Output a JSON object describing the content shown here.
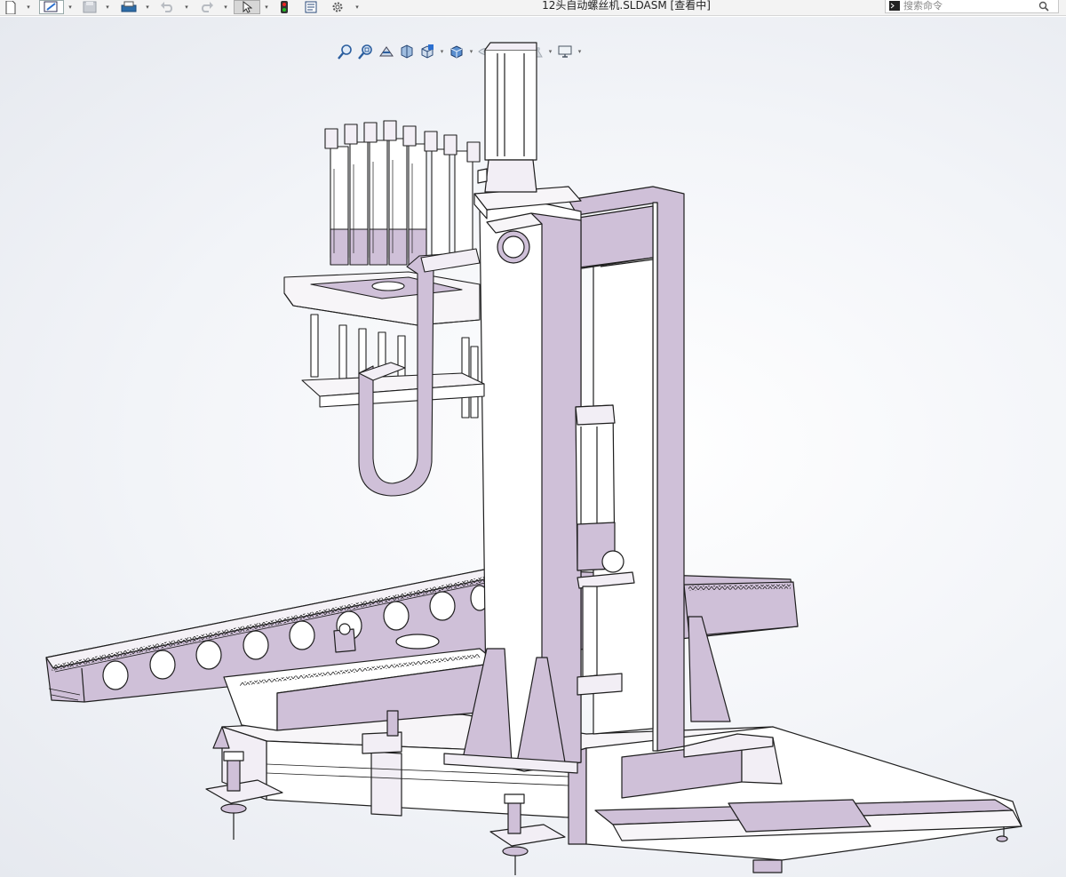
{
  "window": {
    "title": "12头自动螺丝机.SLDASM [查看中]"
  },
  "search": {
    "placeholder": "搜索命令"
  },
  "toolbar": {
    "icons": [
      "new-document-icon",
      "open-icon",
      "save-icon",
      "print-icon",
      "undo-icon",
      "redo-icon",
      "select-arrow-icon",
      "rebuild-traffic-light-icon",
      "file-properties-icon",
      "options-gear-icon"
    ]
  },
  "heads_up_toolbar": {
    "icons": [
      "zoom-to-fit-icon",
      "zoom-to-area-icon",
      "previous-view-icon",
      "section-view-icon",
      "view-orientation-icon",
      "display-style-icon",
      "hide-show-items-icon",
      "edit-appearance-icon",
      "apply-scene-icon",
      "view-settings-icon"
    ]
  },
  "colors": {
    "part_fill": "#cfc0d8",
    "part_fill_dark": "#b9a6c6",
    "outline": "#1e1e1e",
    "background": "#ffffff"
  }
}
